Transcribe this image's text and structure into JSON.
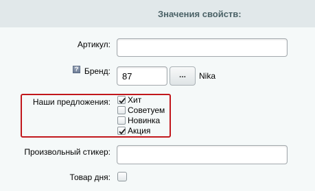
{
  "header": {
    "title": "Значения свойств:"
  },
  "fields": {
    "article": {
      "label": "Артикул:",
      "value": ""
    },
    "brand": {
      "label": "Бренд:",
      "value": "87",
      "button_label": "...",
      "name": "Nika",
      "help_icon": "question-mark-icon"
    },
    "offers": {
      "label": "Наши предложения:",
      "options": [
        {
          "label": "Хит",
          "checked": true
        },
        {
          "label": "Советуем",
          "checked": false
        },
        {
          "label": "Новинка",
          "checked": false
        },
        {
          "label": "Акция",
          "checked": true
        }
      ],
      "highlight_color": "#c1161b"
    },
    "sticker": {
      "label": "Произвольный стикер:",
      "value": ""
    },
    "product_of_day": {
      "label": "Товар дня:",
      "checked": false
    }
  }
}
